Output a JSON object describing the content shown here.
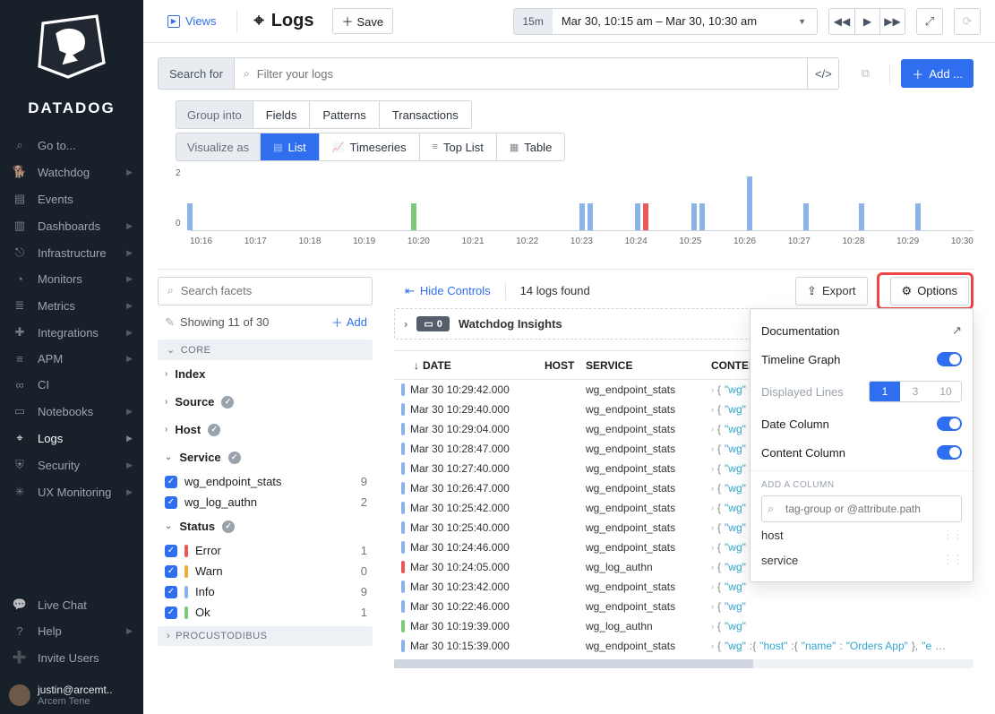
{
  "brand": "DATADOG",
  "nav": {
    "items": [
      {
        "icon": "⌕",
        "label": "Go to..."
      },
      {
        "icon": "🐕",
        "label": "Watchdog",
        "chev": true
      },
      {
        "icon": "▤",
        "label": "Events"
      },
      {
        "icon": "▥",
        "label": "Dashboards",
        "chev": true
      },
      {
        "icon": "⎋",
        "label": "Infrastructure",
        "chev": true
      },
      {
        "icon": "◔",
        "label": "Monitors",
        "chev": true
      },
      {
        "icon": "≣",
        "label": "Metrics",
        "chev": true
      },
      {
        "icon": "✚",
        "label": "Integrations",
        "chev": true
      },
      {
        "icon": "≡",
        "label": "APM",
        "chev": true
      },
      {
        "icon": "∞",
        "label": "CI"
      },
      {
        "icon": "▭",
        "label": "Notebooks",
        "chev": true
      },
      {
        "icon": "⌖",
        "label": "Logs",
        "chev": true,
        "active": true
      },
      {
        "icon": "⛨",
        "label": "Security",
        "chev": true
      },
      {
        "icon": "✳",
        "label": "UX Monitoring",
        "chev": true
      }
    ],
    "bottom": [
      {
        "icon": "💬",
        "label": "Live Chat"
      },
      {
        "icon": "?",
        "label": "Help",
        "chev": true
      },
      {
        "icon": "➕",
        "label": "Invite Users"
      }
    ]
  },
  "user": {
    "email": "justin@arcemt..",
    "name": "Arcem Tene"
  },
  "top": {
    "views": "Views",
    "title": "Logs",
    "save": "Save",
    "time_preset": "15m",
    "time_range": "Mar 30, 10:15 am – Mar 30, 10:30 am",
    "add": "Add ..."
  },
  "search": {
    "label": "Search for",
    "placeholder": "Filter your logs"
  },
  "group": {
    "label": "Group into",
    "opts": [
      "Fields",
      "Patterns",
      "Transactions"
    ]
  },
  "viz": {
    "label": "Visualize as",
    "opts": [
      "List",
      "Timeseries",
      "Top List",
      "Table"
    ],
    "active": 0
  },
  "chart_data": {
    "type": "bar",
    "xlabel": "",
    "ylabel": "",
    "ylim": [
      0,
      2
    ],
    "categories": [
      "10:16",
      "10:17",
      "10:18",
      "10:19",
      "10:20",
      "10:21",
      "10:22",
      "10:23",
      "10:24",
      "10:25",
      "10:26",
      "10:27",
      "10:28",
      "10:29",
      "10:30"
    ],
    "series": [
      {
        "name": "info",
        "color": "#8bb3e8",
        "values": [
          1,
          0,
          0,
          0,
          0,
          0,
          0,
          1,
          1,
          1,
          2,
          1,
          1,
          1,
          0
        ]
      },
      {
        "name": "ok",
        "color": "#7dc97a",
        "values": [
          0,
          0,
          0,
          0,
          1,
          0,
          0,
          0,
          0,
          0,
          0,
          0,
          0,
          0,
          0
        ]
      },
      {
        "name": "error",
        "color": "#e85959",
        "values": [
          0,
          0,
          0,
          0,
          0,
          0,
          0,
          0,
          1,
          0,
          0,
          0,
          0,
          0,
          0
        ]
      }
    ],
    "extra_info_at": {
      "10:23": [
        0,
        1
      ],
      "10:25": [
        0,
        1
      ]
    }
  },
  "mid": {
    "facet_placeholder": "Search facets",
    "hide": "Hide Controls",
    "count": "14 logs found",
    "export": "Export",
    "options": "Options"
  },
  "facets": {
    "showing": "Showing 11 of 30",
    "add": "Add",
    "groups": [
      {
        "name": "CORE",
        "items": [
          {
            "type": "accord",
            "label": "Index"
          },
          {
            "type": "accord",
            "label": "Source",
            "badge": true
          },
          {
            "type": "accord",
            "label": "Host",
            "badge": true
          },
          {
            "type": "accord",
            "label": "Service",
            "badge": true,
            "open": true,
            "children": [
              {
                "label": "wg_endpoint_stats",
                "count": 9
              },
              {
                "label": "wg_log_authn",
                "count": 2
              }
            ]
          },
          {
            "type": "accord",
            "label": "Status",
            "badge": true,
            "open": true,
            "children": [
              {
                "label": "Error",
                "count": 1,
                "color": "#e85959"
              },
              {
                "label": "Warn",
                "count": 0,
                "color": "#f0a93c"
              },
              {
                "label": "Info",
                "count": 9,
                "color": "#8bb3e8"
              },
              {
                "label": "Ok",
                "count": 1,
                "color": "#7dc97a"
              }
            ]
          }
        ]
      },
      {
        "name": "PROCUSTODIBUS",
        "items": []
      }
    ]
  },
  "insights": {
    "count": 0,
    "label": "Watchdog Insights"
  },
  "table": {
    "headers": {
      "date": "DATE",
      "host": "HOST",
      "service": "SERVICE",
      "content": "CONTENT"
    },
    "rows": [
      {
        "c": "#8bb3e8",
        "date": "Mar 30 10:29:42.000",
        "svc": "wg_endpoint_stats",
        "content": "wg"
      },
      {
        "c": "#8bb3e8",
        "date": "Mar 30 10:29:40.000",
        "svc": "wg_endpoint_stats",
        "content": "wg"
      },
      {
        "c": "#8bb3e8",
        "date": "Mar 30 10:29:04.000",
        "svc": "wg_endpoint_stats",
        "content": "wg"
      },
      {
        "c": "#8bb3e8",
        "date": "Mar 30 10:28:47.000",
        "svc": "wg_endpoint_stats",
        "content": "wg"
      },
      {
        "c": "#8bb3e8",
        "date": "Mar 30 10:27:40.000",
        "svc": "wg_endpoint_stats",
        "content": "wg"
      },
      {
        "c": "#8bb3e8",
        "date": "Mar 30 10:26:47.000",
        "svc": "wg_endpoint_stats",
        "content": "wg"
      },
      {
        "c": "#8bb3e8",
        "date": "Mar 30 10:25:42.000",
        "svc": "wg_endpoint_stats",
        "content": "wg"
      },
      {
        "c": "#8bb3e8",
        "date": "Mar 30 10:25:40.000",
        "svc": "wg_endpoint_stats",
        "content": "wg"
      },
      {
        "c": "#8bb3e8",
        "date": "Mar 30 10:24:46.000",
        "svc": "wg_endpoint_stats",
        "content": "wg"
      },
      {
        "c": "#e85959",
        "date": "Mar 30 10:24:05.000",
        "svc": "wg_log_authn",
        "content": "wg"
      },
      {
        "c": "#8bb3e8",
        "date": "Mar 30 10:23:42.000",
        "svc": "wg_endpoint_stats",
        "content": "wg"
      },
      {
        "c": "#8bb3e8",
        "date": "Mar 30 10:22:46.000",
        "svc": "wg_endpoint_stats",
        "content": "wg"
      },
      {
        "c": "#7dc97a",
        "date": "Mar 30 10:19:39.000",
        "svc": "wg_log_authn",
        "content": "wg"
      },
      {
        "c": "#8bb3e8",
        "date": "Mar 30 10:15:39.000",
        "svc": "wg_endpoint_stats",
        "content_full": true
      }
    ],
    "content_full": "{\"wg\":{\"host\":{\"name\":\"Orders App\"},\"e..."
  },
  "options": {
    "doc": "Documentation",
    "timeline": "Timeline Graph",
    "displayed": "Displayed Lines",
    "displayed_opts": [
      "1",
      "3",
      "10"
    ],
    "date": "Date Column",
    "content": "Content Column",
    "add_label": "ADD A COLUMN",
    "add_placeholder": "tag-group or @attribute.path",
    "cols": [
      "host",
      "service"
    ]
  }
}
